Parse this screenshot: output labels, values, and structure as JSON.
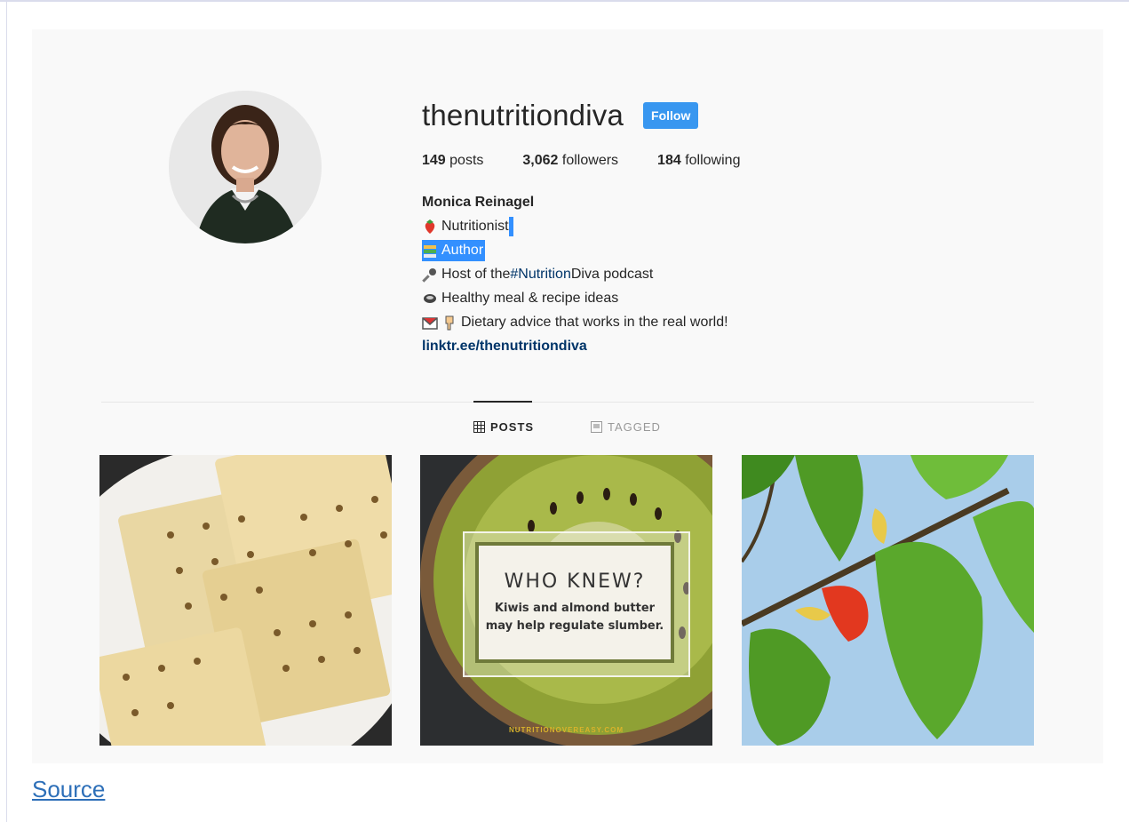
{
  "profile": {
    "username": "thenutritiondiva",
    "follow_label": "Follow",
    "stats": {
      "posts_count": "149",
      "posts_label": "posts",
      "followers_count": "3,062",
      "followers_label": "followers",
      "following_count": "184",
      "following_label": "following"
    }
  },
  "bio": {
    "fullname": "Monica Reinagel",
    "line1": "Nutritionist",
    "line2": "Author",
    "line3_prefix": "Host of the ",
    "line3_hashtag": "#Nutrition",
    "line3_suffix": " Diva podcast",
    "line4": "Healthy meal & recipe ideas",
    "line5": "Dietary advice that works in the real world!",
    "link": "linktr.ee/thenutritiondiva"
  },
  "tabs": {
    "posts": "POSTS",
    "tagged": "TAGGED"
  },
  "posts": {
    "kiwi_title": "WHO KNEW?",
    "kiwi_line1": "Kiwis and almond butter",
    "kiwi_line2": "may  help regulate slumber.",
    "kiwi_footer": "NUTRITIONOVEREASY.COM"
  },
  "source_link": "Source",
  "icons": {
    "line1": "strawberry-icon",
    "line2": "books-icon",
    "line3": "microphone-icon",
    "line4": "bowl-icon",
    "line5": [
      "envelope-icon",
      "pointing-down-icon"
    ]
  },
  "colors": {
    "follow_button": "#3897f0",
    "selection": "#3390ff",
    "link": "#003569",
    "source_link": "#2d6fb8"
  }
}
